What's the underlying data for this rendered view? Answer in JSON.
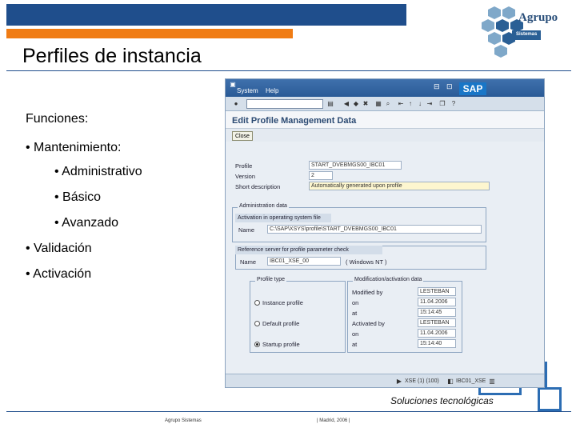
{
  "slide": {
    "title": "Perfiles de instancia",
    "bullets": [
      "Funciones:",
      "• Mantenimiento:",
      "• Administrativo",
      "• Básico",
      "• Avanzado",
      "• Validación",
      "• Activación"
    ],
    "tagline": "Soluciones tecnológicas",
    "footer_left": "Agrupo Sistemas",
    "footer_mid": "| Madrid, 2006 |"
  },
  "logo": {
    "name": "Agrupo",
    "sub": "Sistemas"
  },
  "colors": {
    "brand_blue": "#1f4e8c",
    "brand_orange": "#f07c14",
    "sap_blue": "#2a5a96",
    "field_yellow": "#fdf6cf"
  },
  "sap": {
    "menu": [
      "System",
      "Help"
    ],
    "window_buttons": "⊟ ⊡ ⊠",
    "logo": "SAP",
    "screen_title": "Edit Profile Management Data",
    "close_button": "Close",
    "fields": {
      "profile_label": "Profile",
      "profile_value": "START_DVEBMGS00_IBC01",
      "version_label": "Version",
      "version_value": "2",
      "short_desc_label": "Short description",
      "short_desc_value": "Automatically generated upon profile"
    },
    "admin": {
      "frame_title": "Administration data",
      "activation_header": "Activation in operating system file",
      "name_label": "Name",
      "name_value": "C:\\SAP\\XSYS\\profile\\START_DVEBMGS00_IBC01"
    },
    "reference": {
      "header": "Reference server for profile parameter check",
      "name_label": "Name",
      "name_value": "IBC01_XSE_00",
      "os_value": "( Windows NT )"
    },
    "profile_type": {
      "title": "Profile type",
      "options": [
        "Instance profile",
        "Default profile",
        "Startup profile"
      ],
      "selected": "Startup profile"
    },
    "modification": {
      "title": "Modification/activation data",
      "rows": [
        {
          "label": "Modified by",
          "value": "LESTEBAN"
        },
        {
          "label": "on",
          "value": "11.04.2006"
        },
        {
          "label": "at",
          "value": "15:14:45"
        },
        {
          "label": "Activated by",
          "value": "LESTEBAN"
        },
        {
          "label": "on",
          "value": "11.04.2006"
        },
        {
          "label": "at",
          "value": "15:14:40"
        }
      ]
    },
    "status": {
      "system": "XSE (1) (100)",
      "server": "IBC01_XSE"
    }
  }
}
